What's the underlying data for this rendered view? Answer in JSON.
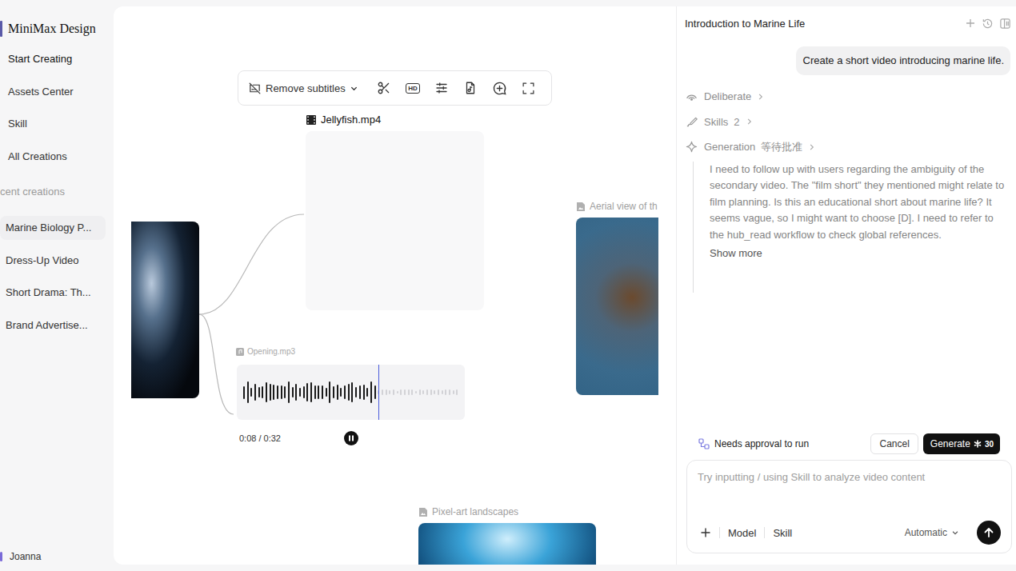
{
  "sidebar": {
    "brand": "MiniMax Design",
    "nav": [
      {
        "label": "Start Creating",
        "selected": true
      },
      {
        "label": "Assets Center",
        "selected": false
      },
      {
        "label": "Skill",
        "selected": false
      },
      {
        "label": "All Creations",
        "selected": false
      }
    ],
    "recent_title": "cent creations",
    "recent": [
      {
        "label": "Marine Biology P...",
        "selected": true
      },
      {
        "label": "Dress-Up Video",
        "selected": false
      },
      {
        "label": "Short Drama: Th...",
        "selected": false
      },
      {
        "label": "Brand Advertise...",
        "selected": false
      }
    ],
    "user": "Joanna"
  },
  "canvas": {
    "toolbar": {
      "subtitle_menu": "Remove subtitles",
      "hd_badge": "HD"
    },
    "nodes": [
      {
        "kind": "source",
        "selected": false
      },
      {
        "kind": "pending",
        "label": "Jellyfish.mp4",
        "selected": true
      },
      {
        "kind": "image",
        "label": "Aerial view of th",
        "selected": false
      },
      {
        "kind": "image",
        "label": "Pixel-art landscapes",
        "selected": false
      }
    ],
    "audio": {
      "name": "Opening.mp3",
      "time": "0:08 / 0:32",
      "level": 0.62,
      "playing": true
    }
  },
  "chat": {
    "title": "Introduction to Marine Life",
    "user_message": "Create a short video introducing marine life.",
    "steps": [
      {
        "kind": "deliberate",
        "label": "Deliberate"
      },
      {
        "kind": "skills",
        "label": "Skills",
        "count": "2"
      },
      {
        "kind": "generation",
        "label": "Generation",
        "status": "等待批准"
      }
    ],
    "thought": "I need to follow up with users regarding the ambiguity of the secondary video. The \"film short\" they mentioned might relate to film planning. Is this an educational short about marine life? It seems vague, so I might want to choose [D]. I need to refer to the hub_read workflow to check global references.",
    "show_more": "Show more",
    "approval": {
      "label": "Needs approval to run",
      "cancel": "Cancel",
      "generate": "Generate",
      "cost": "30"
    },
    "composer": {
      "placeholder": "Try inputting / using Skill to analyze video content",
      "model": "Model",
      "skill": "Skill",
      "mode": "Automatic"
    }
  }
}
